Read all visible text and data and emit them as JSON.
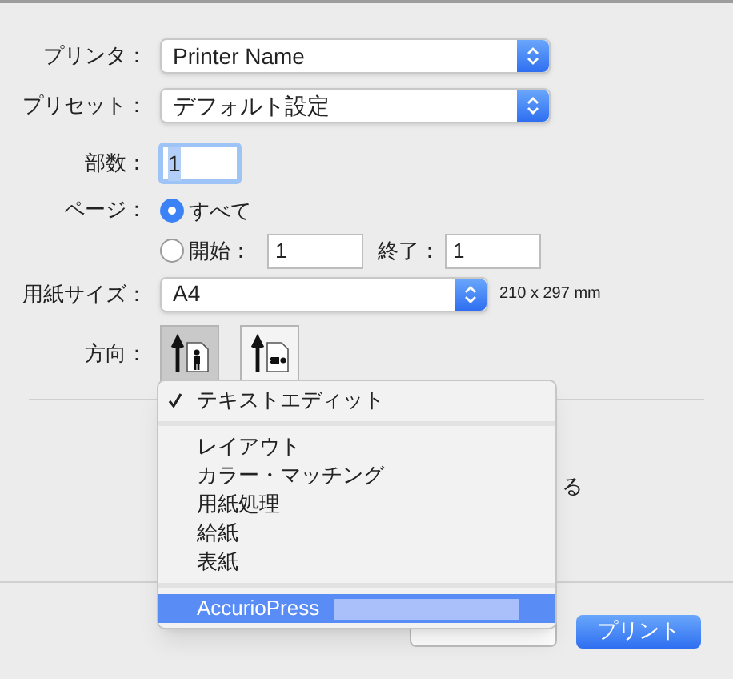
{
  "printer": {
    "label": "プリンタ：",
    "value": "Printer Name"
  },
  "preset": {
    "label": "プリセット：",
    "value": "デフォルト設定"
  },
  "copies": {
    "label": "部数：",
    "value": "1"
  },
  "pages": {
    "label": "ページ：",
    "options": [
      {
        "label": "すべて",
        "selected": true
      },
      {
        "label": "開始：",
        "selected": false
      }
    ],
    "from": "1",
    "to_label": "終了：",
    "to": "1"
  },
  "paper_size": {
    "label": "用紙サイズ：",
    "value": "A4",
    "dimensions": "210 x 297 mm"
  },
  "orientation": {
    "label": "方向：",
    "options": [
      {
        "kind": "portrait",
        "selected": true
      },
      {
        "kind": "landscape",
        "selected": false
      }
    ]
  },
  "hidden_text_fragment": "る",
  "menu": {
    "groups": [
      {
        "items": [
          {
            "label": "テキストエディット",
            "checked": true,
            "highlighted": false
          }
        ]
      },
      {
        "items": [
          {
            "label": "レイアウト",
            "checked": false,
            "highlighted": false
          },
          {
            "label": "カラー・マッチング",
            "checked": false,
            "highlighted": false
          },
          {
            "label": "用紙処理",
            "checked": false,
            "highlighted": false
          },
          {
            "label": "給紙",
            "checked": false,
            "highlighted": false
          },
          {
            "label": "表紙",
            "checked": false,
            "highlighted": false
          }
        ]
      },
      {
        "items": [
          {
            "label": "AccurioPress",
            "checked": false,
            "highlighted": true
          }
        ]
      }
    ]
  },
  "buttons": {
    "print": "プリント"
  }
}
